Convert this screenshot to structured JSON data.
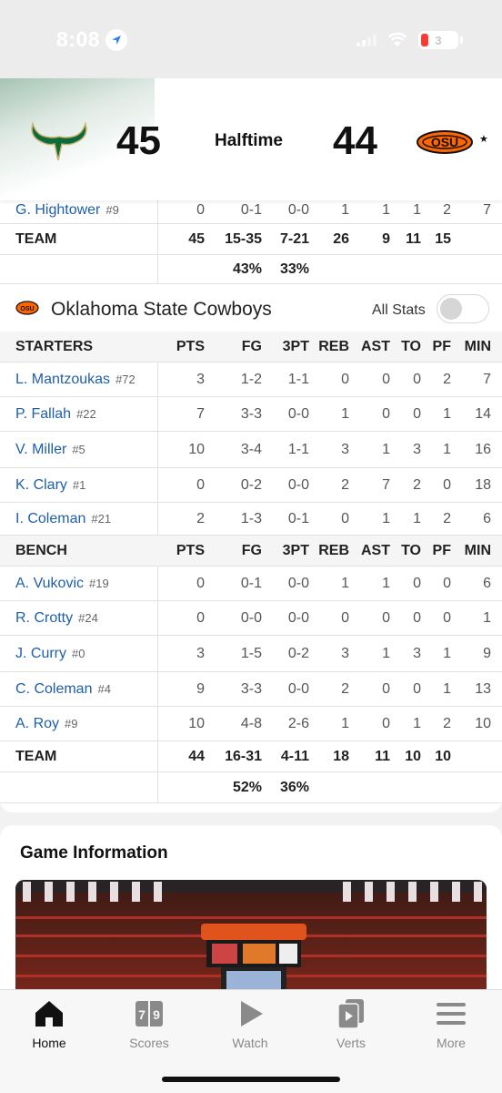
{
  "status_bar": {
    "time": "8:08",
    "battery": "3"
  },
  "header": {
    "home_score": "45",
    "status": "Halftime",
    "away_score": "44"
  },
  "prev_team": {
    "last_player": {
      "name": "G. Hightower",
      "number": "#9",
      "stats": [
        "0",
        "0-1",
        "0-0",
        "1",
        "1",
        "1",
        "2",
        "7"
      ]
    },
    "team_row": {
      "label": "TEAM",
      "stats": [
        "45",
        "15-35",
        "7-21",
        "26",
        "9",
        "11",
        "15",
        ""
      ]
    },
    "pct_row": [
      "43%",
      "33%"
    ]
  },
  "team": {
    "name": "Oklahoma State Cowboys",
    "all_stats_label": "All Stats"
  },
  "columns": [
    "PTS",
    "FG",
    "3PT",
    "REB",
    "AST",
    "TO",
    "PF",
    "MIN"
  ],
  "starters_label": "STARTERS",
  "bench_label": "BENCH",
  "starters": [
    {
      "name": "L. Mantzoukas",
      "number": "#72",
      "stats": [
        "3",
        "1-2",
        "1-1",
        "0",
        "0",
        "0",
        "2",
        "7"
      ]
    },
    {
      "name": "P. Fallah",
      "number": "#22",
      "stats": [
        "7",
        "3-3",
        "0-0",
        "1",
        "0",
        "0",
        "1",
        "14"
      ]
    },
    {
      "name": "V. Miller",
      "number": "#5",
      "stats": [
        "10",
        "3-4",
        "1-1",
        "3",
        "1",
        "3",
        "1",
        "16"
      ]
    },
    {
      "name": "K. Clary",
      "number": "#1",
      "stats": [
        "0",
        "0-2",
        "0-0",
        "2",
        "7",
        "2",
        "0",
        "18"
      ]
    },
    {
      "name": "I. Coleman",
      "number": "#21",
      "stats": [
        "2",
        "1-3",
        "0-1",
        "0",
        "1",
        "1",
        "2",
        "6"
      ]
    }
  ],
  "bench": [
    {
      "name": "A. Vukovic",
      "number": "#19",
      "stats": [
        "0",
        "0-1",
        "0-0",
        "1",
        "1",
        "0",
        "0",
        "6"
      ]
    },
    {
      "name": "R. Crotty",
      "number": "#24",
      "stats": [
        "0",
        "0-0",
        "0-0",
        "0",
        "0",
        "0",
        "0",
        "1"
      ]
    },
    {
      "name": "J. Curry",
      "number": "#0",
      "stats": [
        "3",
        "1-5",
        "0-2",
        "3",
        "1",
        "3",
        "1",
        "9"
      ]
    },
    {
      "name": "C. Coleman",
      "number": "#4",
      "stats": [
        "9",
        "3-3",
        "0-0",
        "2",
        "0",
        "0",
        "1",
        "13"
      ]
    },
    {
      "name": "A. Roy",
      "number": "#9",
      "stats": [
        "10",
        "4-8",
        "2-6",
        "1",
        "0",
        "1",
        "2",
        "10"
      ]
    }
  ],
  "team_totals": {
    "label": "TEAM",
    "stats": [
      "44",
      "16-31",
      "4-11",
      "18",
      "11",
      "10",
      "10",
      ""
    ]
  },
  "team_pct": [
    "52%",
    "36%"
  ],
  "game_info": {
    "title": "Game Information"
  },
  "tabs": [
    {
      "label": "Home",
      "icon": "home-icon",
      "active": true
    },
    {
      "label": "Scores",
      "icon": "scores-icon",
      "active": false
    },
    {
      "label": "Watch",
      "icon": "play-icon",
      "active": false
    },
    {
      "label": "Verts",
      "icon": "verts-icon",
      "active": false
    },
    {
      "label": "More",
      "icon": "menu-icon",
      "active": false
    }
  ],
  "colors": {
    "usf_green": "#0b6b3a",
    "usf_gold": "#c8b26a",
    "osu_orange": "#ff6600",
    "link_blue": "#1e5fa8"
  }
}
